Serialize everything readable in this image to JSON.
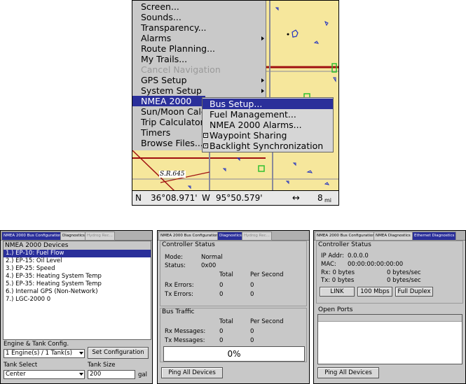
{
  "map_screen": {
    "main_menu": [
      {
        "label": "Screen...",
        "state": "normal",
        "submenu": false
      },
      {
        "label": "Sounds...",
        "state": "normal",
        "submenu": false
      },
      {
        "label": "Transparency...",
        "state": "normal",
        "submenu": false
      },
      {
        "label": "Alarms",
        "state": "normal",
        "submenu": true
      },
      {
        "label": "Route Planning...",
        "state": "normal",
        "submenu": false
      },
      {
        "label": "My Trails...",
        "state": "normal",
        "submenu": false
      },
      {
        "label": "Cancel Navigation",
        "state": "disabled",
        "submenu": false
      },
      {
        "label": "GPS Setup",
        "state": "normal",
        "submenu": true
      },
      {
        "label": "System Setup",
        "state": "normal",
        "submenu": true
      },
      {
        "label": "NMEA 2000",
        "state": "selected",
        "submenu": false
      },
      {
        "label": "Sun/Moon Calc",
        "state": "normal",
        "submenu": false
      },
      {
        "label": "Trip Calculator",
        "state": "normal",
        "submenu": false
      },
      {
        "label": "Timers",
        "state": "normal",
        "submenu": false
      },
      {
        "label": "Browse Files...",
        "state": "normal",
        "submenu": false
      }
    ],
    "sub_menu": [
      {
        "label": "Bus Setup...",
        "selected": true,
        "checkbox": false
      },
      {
        "label": "Fuel Management...",
        "selected": false,
        "checkbox": false
      },
      {
        "label": "NMEA 2000 Alarms...",
        "selected": false,
        "checkbox": false
      },
      {
        "label": "Waypoint Sharing",
        "selected": false,
        "checkbox": true
      },
      {
        "label": "Backlight Synchronization",
        "selected": false,
        "checkbox": true
      }
    ],
    "map_label": "S.R.645",
    "status": {
      "lat_dir": "N",
      "lat": "36°08.971'",
      "lon_dir": "W",
      "lon": "95°50.579'",
      "scale_icon": "↔",
      "scale": "8",
      "scale_unit": "mi"
    },
    "colors": {
      "map_bg": "#f6e79c",
      "road_red": "#a01010",
      "road_gray": "#8a8a9a",
      "water": "#2030c0",
      "green": "#30c030",
      "menu_sel": "#2a2f9a"
    }
  },
  "panel1": {
    "tabs": [
      "NMEA 2000 Bus Configuration",
      "Diagnostics",
      "Hydrog Rec..."
    ],
    "list_header": "NMEA 2000 Devices",
    "devices": [
      "1.) EP-10: Fuel Flow",
      "2.) EP-15: Oil Level",
      "3.) EP-25: Speed",
      "4.) EP-35: Heating System Temp",
      "5.) EP-35: Heating System Temp",
      "6.) Internal GPS (Non-Network)",
      "7.) LGC-2000 0"
    ],
    "engine_label": "Engine & Tank Config.",
    "engine_value": "1 Engine(s) / 1 Tank(s)",
    "set_config_button": "Set Configuration",
    "tank_select_label": "Tank Select",
    "tank_select_value": "Center",
    "tank_size_label": "Tank Size",
    "tank_size_value": "200",
    "tank_size_unit": "gal"
  },
  "panel2": {
    "tabs": [
      "NMEA 2000 Bus Configuration",
      "Diagnostics",
      "Hydrog Rec..."
    ],
    "controller_title": "Controller Status",
    "mode_label": "Mode:",
    "mode_value": "Normal",
    "status_label": "Status:",
    "status_value": "0x00",
    "col_total": "Total",
    "col_per_second": "Per Second",
    "rx_errors_label": "Rx Errors:",
    "rx_errors_total": "0",
    "rx_errors_ps": "0",
    "tx_errors_label": "Tx Errors:",
    "tx_errors_total": "0",
    "tx_errors_ps": "0",
    "bus_title": "Bus Traffic",
    "rx_msg_label": "Rx Messages:",
    "rx_msg_total": "0",
    "rx_msg_ps": "0",
    "tx_msg_label": "Tx Messages:",
    "tx_msg_total": "0",
    "tx_msg_ps": "0",
    "bus_load": "0%",
    "ping_button": "Ping All Devices"
  },
  "panel3": {
    "tabs": [
      "NMEA 2000 Bus Configuration",
      "NMEA Diagnostics",
      "Ethernet Diagnostics"
    ],
    "controller_title": "Controller Status",
    "ip_label": "IP Addr:",
    "ip_value": "0.0.0.0",
    "mac_label": "MAC:",
    "mac_value": "00:00:00:00:00:00",
    "rx_label": "Rx: 0 bytes",
    "rx_rate": "0 bytes/sec",
    "tx_label": "Tx: 0 bytes",
    "tx_rate": "0 bytes/sec",
    "link_button": "LINK",
    "speed_button": "100 Mbps",
    "duplex_button": "Full Duplex",
    "open_ports_title": "Open Ports",
    "ping_button": "Ping All Devices"
  }
}
